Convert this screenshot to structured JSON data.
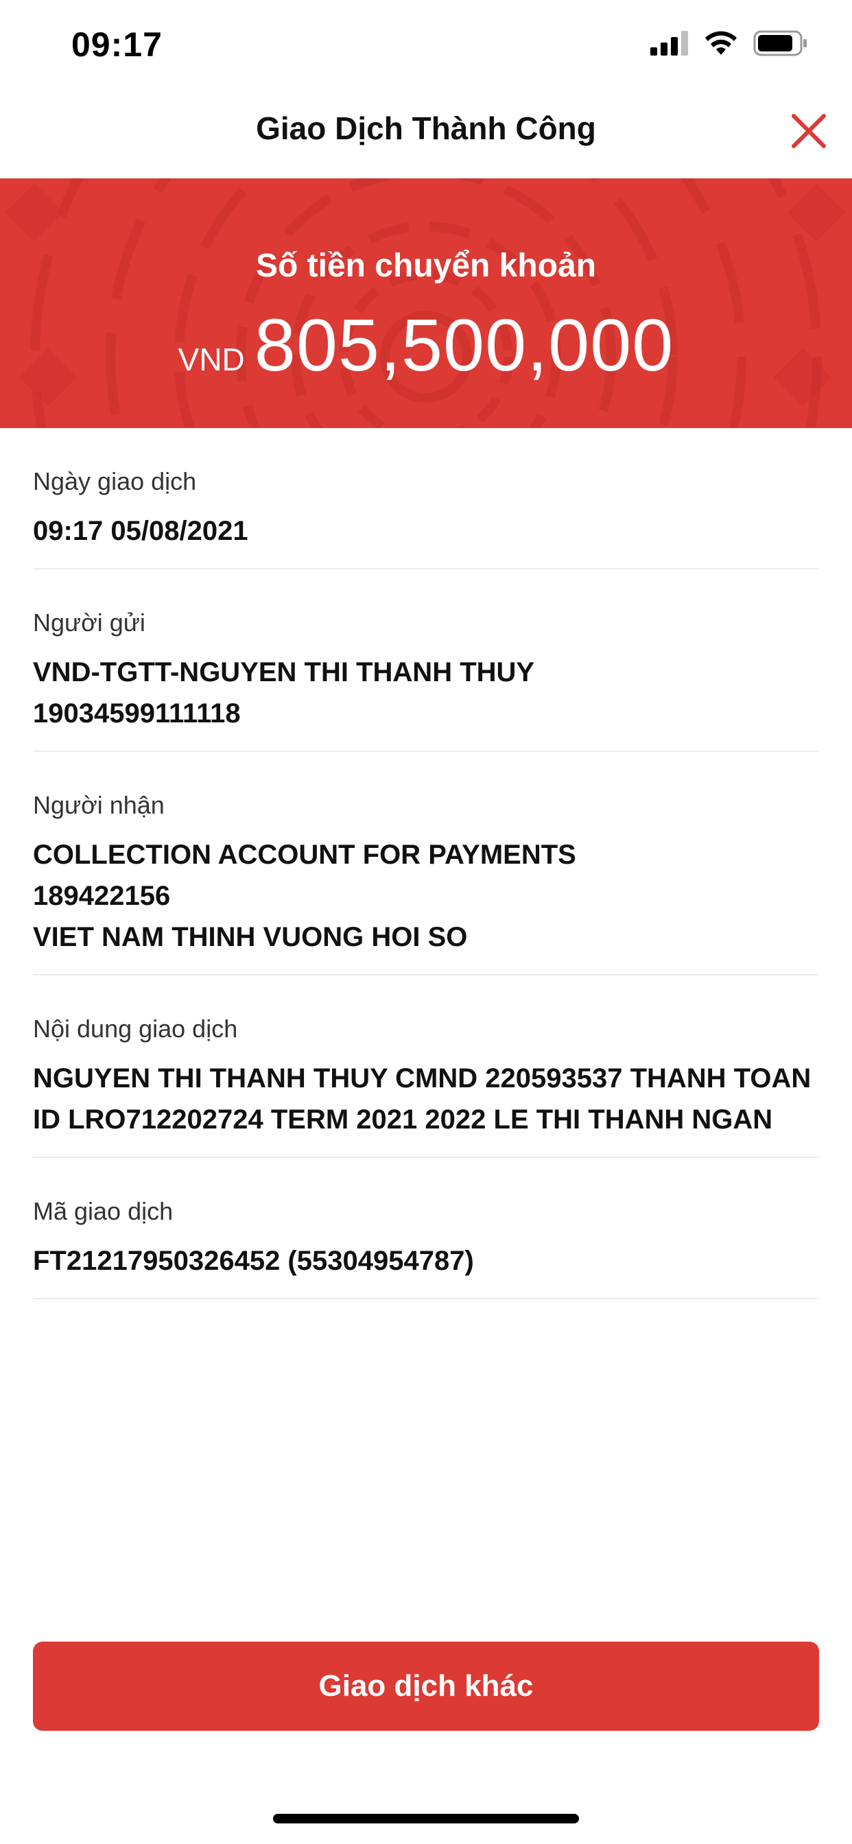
{
  "status_bar": {
    "time": "09:17"
  },
  "header": {
    "title": "Giao Dịch Thành Công"
  },
  "banner": {
    "label": "Số tiền chuyển khoản",
    "currency": "VND",
    "amount": "805,500,000",
    "color": "#dc3a35"
  },
  "details": {
    "date": {
      "label": "Ngày giao dịch",
      "value": "09:17 05/08/2021"
    },
    "sender": {
      "label": "Người gửi",
      "lines": [
        "VND-TGTT-NGUYEN THI THANH THUY",
        "19034599111118"
      ]
    },
    "receiver": {
      "label": "Người nhận",
      "lines": [
        "COLLECTION ACCOUNT FOR PAYMENTS",
        "189422156",
        "VIET NAM THINH VUONG HOI SO"
      ]
    },
    "content": {
      "label": "Nội dung giao dịch",
      "value": "NGUYEN THI THANH THUY CMND 220593537 THANH TOAN ID LRO712202724 TERM 2021 2022 LE THI THANH NGAN"
    },
    "code": {
      "label": "Mã giao dịch",
      "value": "FT21217950326452 (55304954787)"
    }
  },
  "actions": {
    "other_transaction_label": "Giao dịch khác"
  },
  "icons": {
    "signal": "cellular-signal-icon",
    "wifi": "wifi-icon",
    "battery": "battery-icon",
    "close": "close-icon"
  }
}
